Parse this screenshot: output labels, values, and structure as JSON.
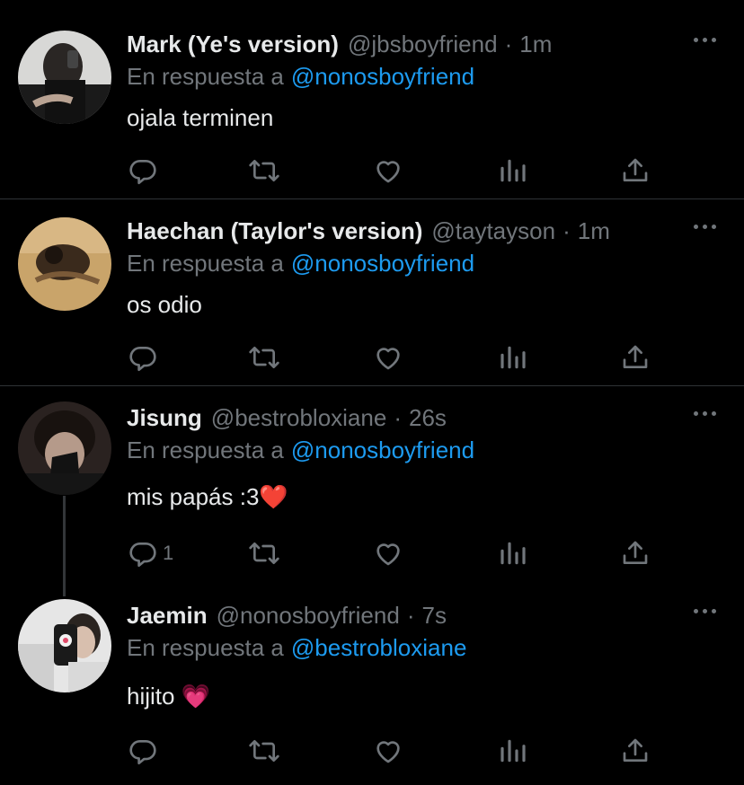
{
  "tweets": [
    {
      "name": "Mark (Ye's version)",
      "handle": "@jbsboyfriend",
      "time": "1m",
      "reply_prefix": "En respuesta a",
      "reply_to": "@nonosboyfriend",
      "text": "ojala terminen",
      "reply_count": ""
    },
    {
      "name": "Haechan (Taylor's version)",
      "handle": "@taytayson",
      "time": "1m",
      "reply_prefix": "En respuesta a",
      "reply_to": "@nonosboyfriend",
      "text": "os odio",
      "reply_count": ""
    },
    {
      "name": "Jisung",
      "handle": "@bestrobloxiane",
      "time": "26s",
      "reply_prefix": "En respuesta a",
      "reply_to": "@nonosboyfriend",
      "text": "mis papás :3",
      "emoji": "❤️",
      "reply_count": "1"
    },
    {
      "name": "Jaemin",
      "handle": "@nonosboyfriend",
      "time": "7s",
      "reply_prefix": "En respuesta a",
      "reply_to": "@bestrobloxiane",
      "text": "hijito",
      "emoji": "💗",
      "reply_count": ""
    }
  ],
  "separator": "·",
  "colors": {
    "background": "#000000",
    "text": "#e7e9ea",
    "muted": "#71767b",
    "link": "#1d9bf0",
    "divider": "#2f3336"
  },
  "icons": [
    "reply-icon",
    "retweet-icon",
    "like-icon",
    "analytics-icon",
    "share-icon",
    "more-icon"
  ]
}
